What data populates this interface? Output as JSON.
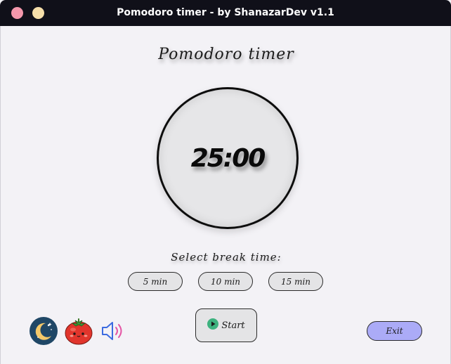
{
  "window": {
    "title": "Pomodoro timer - by ShanazarDev  v1.1"
  },
  "app": {
    "title": "Pomodoro timer",
    "timer": "25:00",
    "break_label": "Select break time:",
    "break_options": [
      "5 min",
      "10 min",
      "15 min"
    ],
    "start_label": "Start",
    "exit_label": "Exit"
  },
  "icons": {
    "theme": "moon-icon",
    "tomato": "tomato-icon",
    "sound": "speaker-icon",
    "play": "play-icon"
  },
  "colors": {
    "titlebar": "#101019",
    "close_button": "#f498ac",
    "minimize_button": "#f6dfaa",
    "exit_button": "#ababf7",
    "play_icon": "#3db27f",
    "moon_background": "#1f4766",
    "moon": "#f4c96a"
  }
}
